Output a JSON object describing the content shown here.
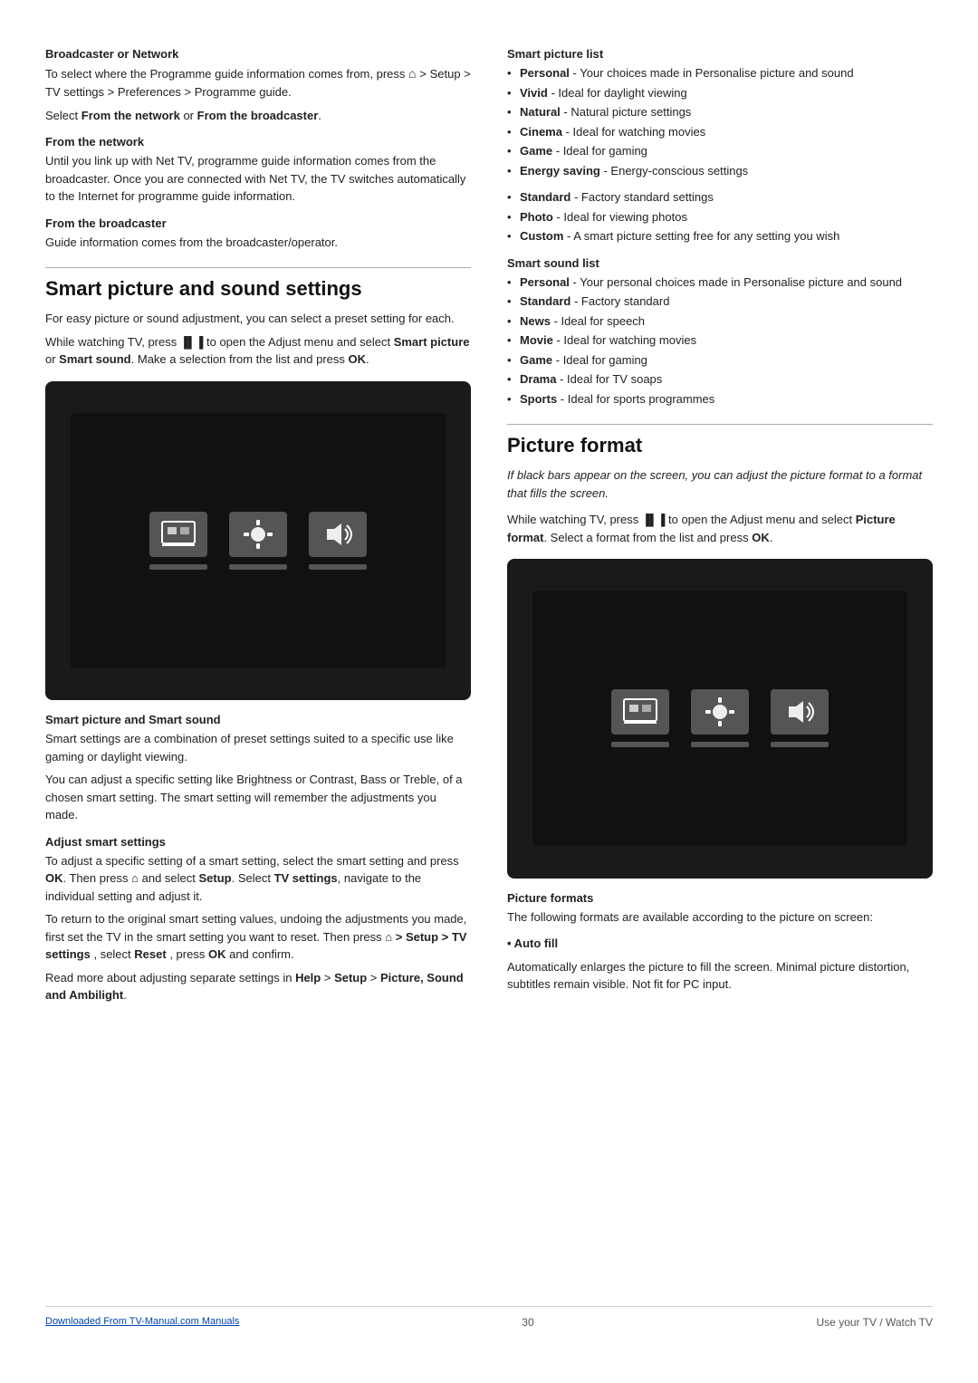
{
  "page": {
    "number": "30",
    "footer_right": "Use your TV / Watch TV",
    "footer_link": "Downloaded From TV-Manual.com Manuals"
  },
  "left_col": {
    "broadcaster_section": {
      "heading": "Broadcaster or Network",
      "para1": "To select where the Programme guide information comes from, press",
      "para1_icon": "⌂",
      "para1_path": "> Setup > TV settings > Preferences > Programme guide.",
      "para2_prefix": "Select ",
      "para2_bold1": "From the network",
      "para2_or": " or ",
      "para2_bold2": "From the broadcaster",
      "para2_end": "."
    },
    "from_network": {
      "heading": "From the network",
      "para": "Until you link up with Net TV, programme guide information comes from the broadcaster. Once you are connected with Net TV, the TV switches automatically to the Internet for programme guide information."
    },
    "from_broadcaster": {
      "heading": "From the broadcaster",
      "para": "Guide information comes from the broadcaster/operator."
    },
    "smart_section": {
      "title": "Smart picture and sound settings",
      "para1": "For easy picture or sound adjustment, you can select a preset setting for each.",
      "para2_prefix": "While watching TV, press ",
      "para2_icon": "▐▌▐",
      "para2_mid": " to open the Adjust menu and select ",
      "para2_bold1": "Smart picture",
      "para2_or": " or ",
      "para2_bold2": "Smart sound",
      "para2_end": ". Make a selection from the list and press ",
      "para2_ok": "OK",
      "para2_period": "."
    },
    "smart_sound_heading": {
      "heading": "Smart picture and Smart sound",
      "para": "Smart settings are a combination of preset settings suited to a specific use like gaming or daylight viewing.",
      "para2": "You can adjust a specific setting like Brightness or Contrast, Bass or Treble, of a chosen smart setting. The smart setting will remember the adjustments you made."
    },
    "adjust_smart": {
      "heading": "Adjust smart settings",
      "para1_prefix": "To adjust a specific setting of a smart setting, select the smart setting and press ",
      "para1_ok": "OK",
      "para1_mid": ". Then press ",
      "para1_icon": "⌂",
      "para1_mid2": " and select ",
      "para1_bold1": "Setup",
      "para1_end": ". Select ",
      "para1_bold2": "TV settings",
      "para1_end2": ", navigate to the individual setting and adjust it.",
      "para2": "To return to the original smart setting values, undoing the adjustments you made, first set the TV in the smart setting you want to reset. Then press",
      "para2_icon": "⌂",
      "para2_mid": "> Setup > TV settings",
      "para2_end": ", select",
      "para2_reset": "Reset",
      "para2_press": ", press",
      "para2_ok": "OK",
      "para2_confirm": "and confirm.",
      "para3_prefix": "Read more about adjusting separate settings in ",
      "para3_bold1": "Help",
      "para3_mid": " > ",
      "para3_bold2": "Setup",
      "para3_end": " > ",
      "para3_bold3": "Picture, Sound and Ambilight",
      "para3_period": "."
    }
  },
  "right_col": {
    "smart_picture_list": {
      "heading": "Smart picture list",
      "items": [
        {
          "bold": "Personal",
          "text": " - Your choices made in Personalise picture and sound"
        },
        {
          "bold": "Vivid",
          "text": " - Ideal for daylight viewing"
        },
        {
          "bold": "Natural",
          "text": " - Natural picture settings"
        },
        {
          "bold": "Cinema",
          "text": " - Ideal for watching movies"
        },
        {
          "bold": "Game",
          "text": " - Ideal for gaming"
        },
        {
          "bold": "Energy saving",
          "text": " - Energy-conscious settings"
        }
      ],
      "items2": [
        {
          "bold": "Standard",
          "text": " - Factory standard settings"
        },
        {
          "bold": "Photo",
          "text": " - Ideal for viewing photos"
        },
        {
          "bold": "Custom",
          "text": " - A smart picture setting free for any setting you wish"
        }
      ]
    },
    "smart_sound_list": {
      "heading": "Smart sound list",
      "items": [
        {
          "bold": "Personal",
          "text": " - Your personal choices made in Personalise picture and sound"
        },
        {
          "bold": "Standard",
          "text": " - Factory standard"
        },
        {
          "bold": "News",
          "text": " - Ideal for speech"
        },
        {
          "bold": "Movie",
          "text": " - Ideal for watching movies"
        },
        {
          "bold": "Game",
          "text": " - Ideal for gaming"
        },
        {
          "bold": "Drama",
          "text": " - Ideal for TV soaps"
        },
        {
          "bold": "Sports",
          "text": " - Ideal for sports programmes"
        }
      ]
    },
    "picture_format": {
      "title": "Picture format",
      "italic_para": "If black bars appear on the screen, you can adjust the picture format to a format that fills the screen.",
      "para_prefix": "While watching TV, press ",
      "para_icon": "▐▌▐",
      "para_mid": " to open the Adjust menu and select ",
      "para_bold": "Picture format",
      "para_end": ". Select a format from the list and press ",
      "para_ok": "OK",
      "para_period": "."
    },
    "picture_formats_section": {
      "heading": "Picture formats",
      "para": "The following formats are available according to the picture on screen:",
      "auto_fill": {
        "label": "• Auto fill",
        "para": "Automatically enlarges the picture to fill the screen. Minimal picture distortion, subtitles remain visible. Not fit for PC input."
      }
    }
  }
}
